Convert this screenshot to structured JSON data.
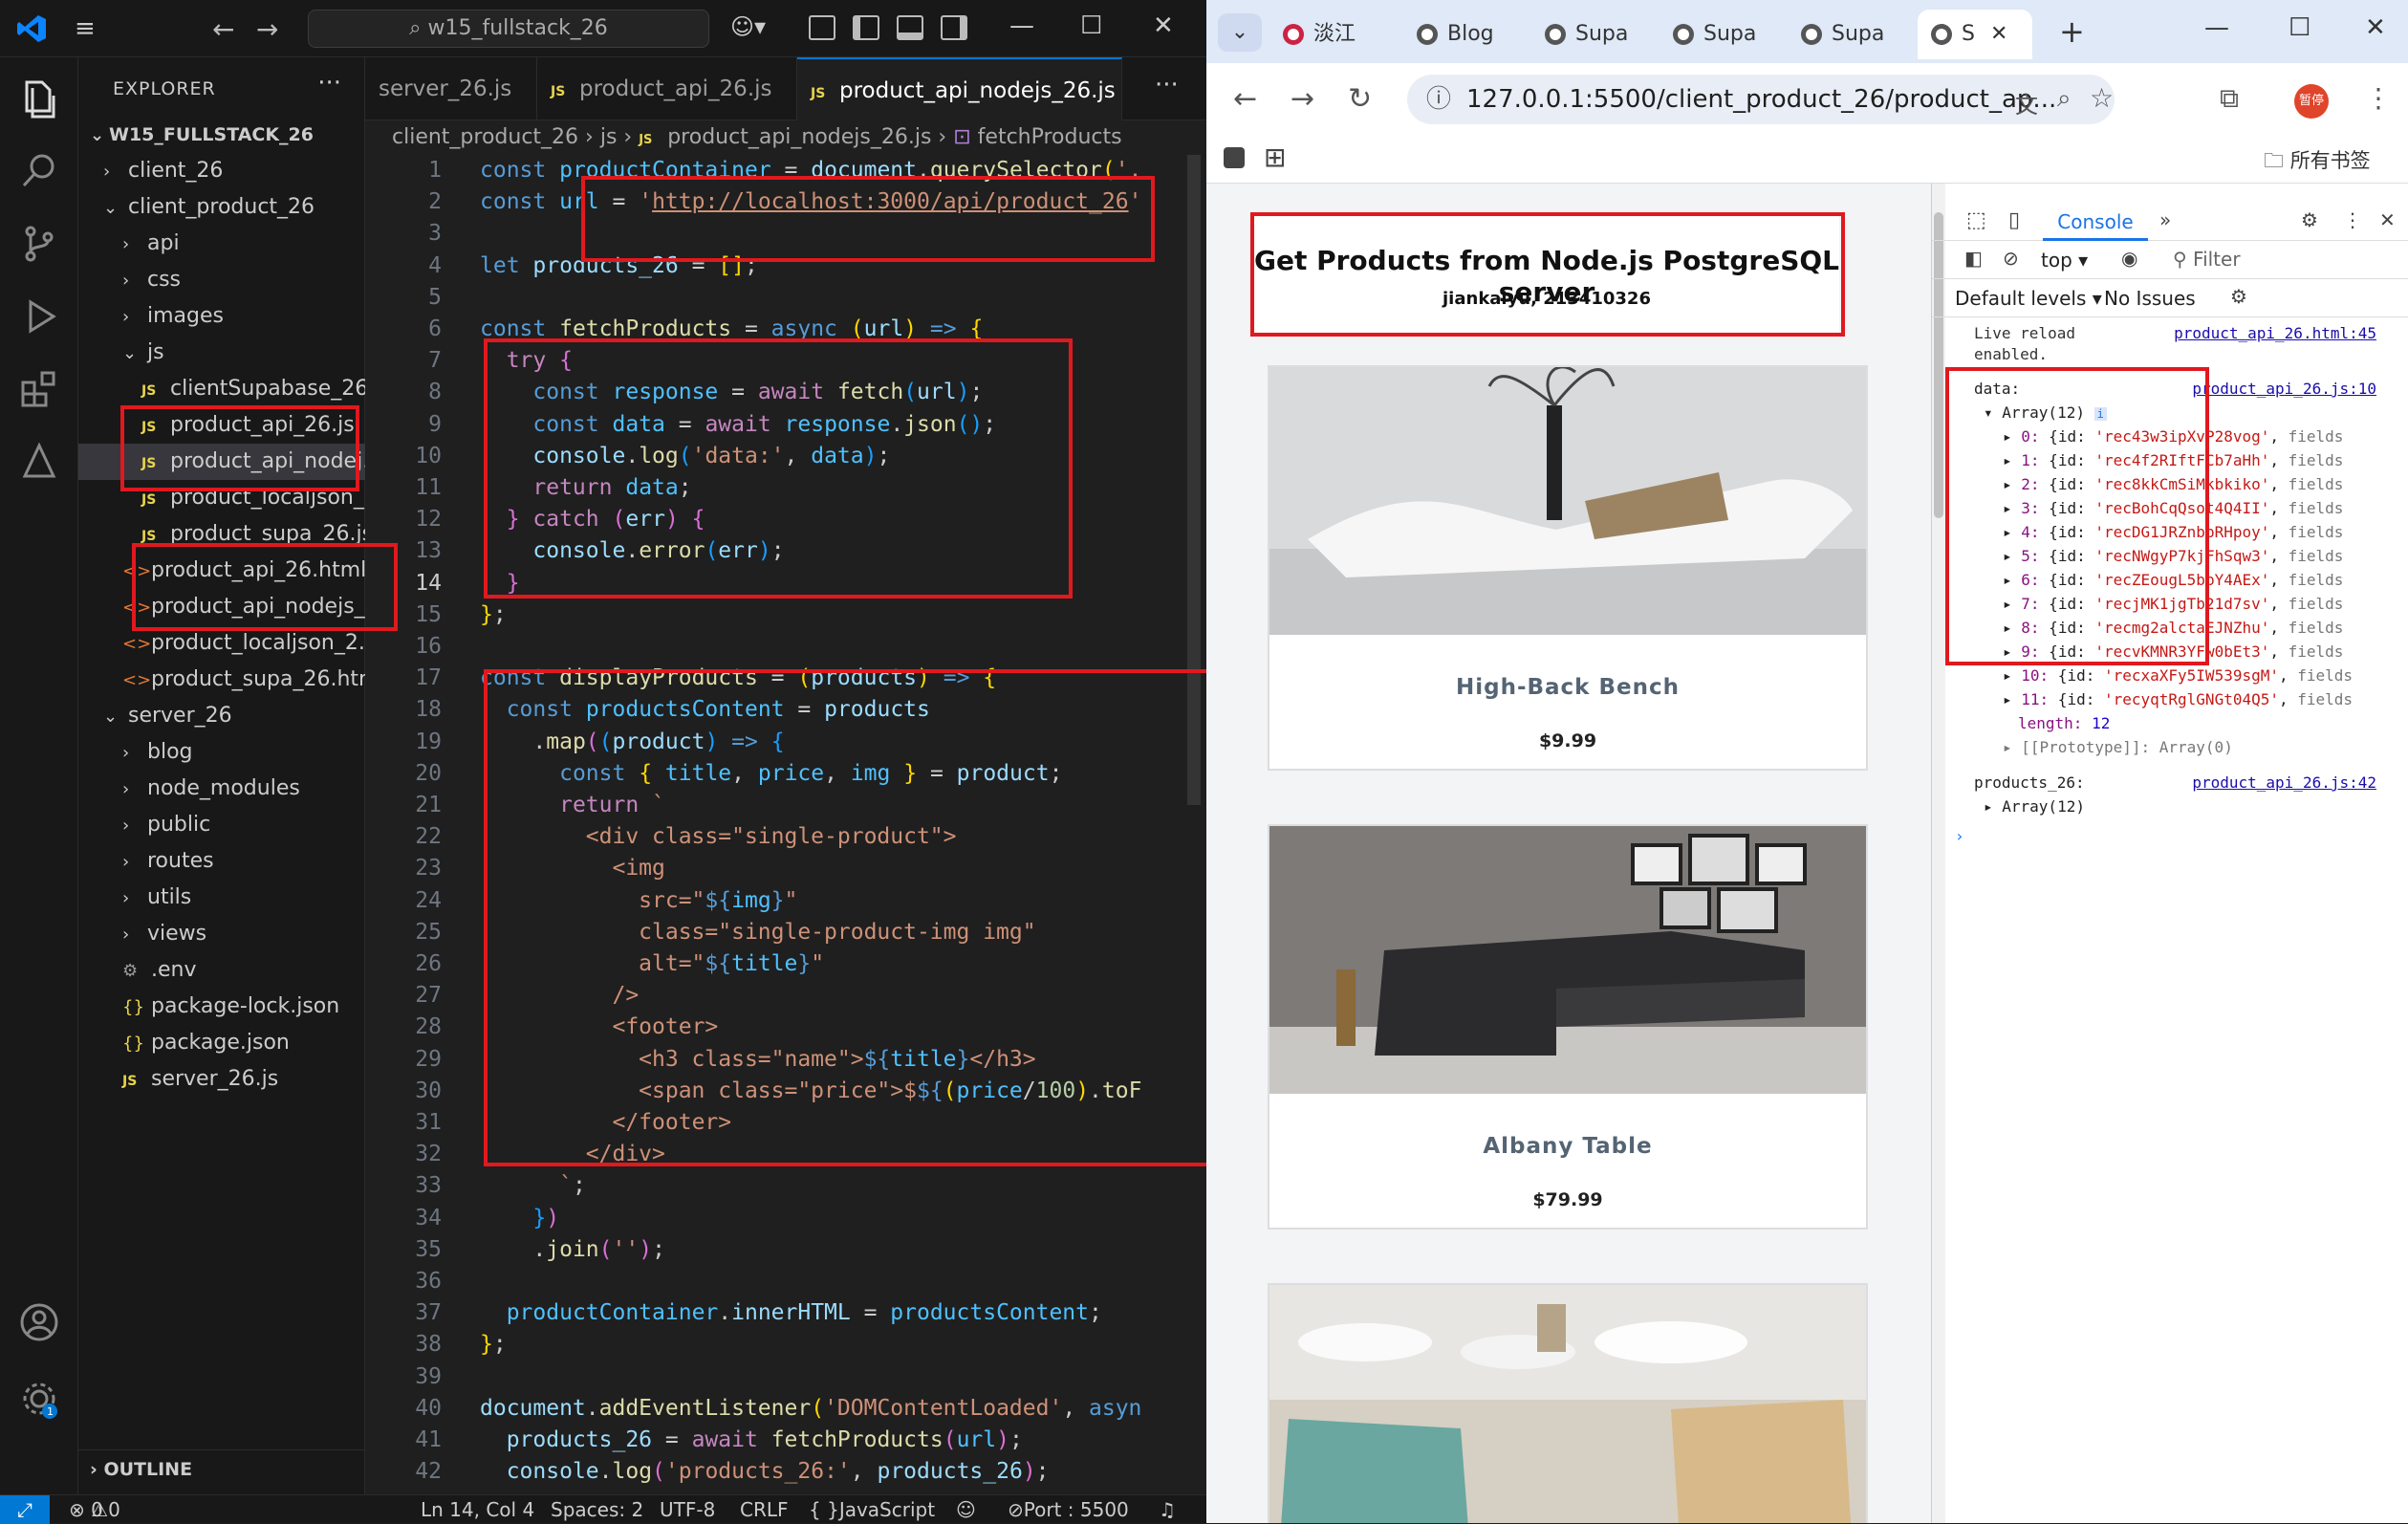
{
  "vscode": {
    "search": "w15_fullstack_26",
    "explorer_title": "EXPLORER",
    "root": "W15_FULLSTACK_26",
    "tree": [
      {
        "label": "client_26",
        "kind": "folder-closed",
        "indent": 1
      },
      {
        "label": "client_product_26",
        "kind": "folder-open",
        "indent": 1
      },
      {
        "label": "api",
        "kind": "folder-closed",
        "indent": 2
      },
      {
        "label": "css",
        "kind": "folder-closed",
        "indent": 2
      },
      {
        "label": "images",
        "kind": "folder-closed",
        "indent": 2
      },
      {
        "label": "js",
        "kind": "folder-open",
        "indent": 2
      },
      {
        "label": "clientSupabase_26.js",
        "kind": "js",
        "indent": 3
      },
      {
        "label": "product_api_26.js",
        "kind": "js",
        "indent": 3
      },
      {
        "label": "product_api_nodej...",
        "kind": "js",
        "indent": 3,
        "selected": true
      },
      {
        "label": "product_localjson_...",
        "kind": "js",
        "indent": 3
      },
      {
        "label": "product_supa_26.js",
        "kind": "js",
        "indent": 3
      },
      {
        "label": "product_api_26.html",
        "kind": "html",
        "indent": 2
      },
      {
        "label": "product_api_nodejs_...",
        "kind": "html",
        "indent": 2
      },
      {
        "label": "product_localjson_2...",
        "kind": "html",
        "indent": 2
      },
      {
        "label": "product_supa_26.html",
        "kind": "html",
        "indent": 2
      },
      {
        "label": "server_26",
        "kind": "folder-open",
        "indent": 1
      },
      {
        "label": "blog",
        "kind": "folder-closed",
        "indent": 2
      },
      {
        "label": "node_modules",
        "kind": "folder-closed",
        "indent": 2
      },
      {
        "label": "public",
        "kind": "folder-closed",
        "indent": 2
      },
      {
        "label": "routes",
        "kind": "folder-closed",
        "indent": 2
      },
      {
        "label": "utils",
        "kind": "folder-closed",
        "indent": 2
      },
      {
        "label": "views",
        "kind": "folder-closed",
        "indent": 2
      },
      {
        "label": ".env",
        "kind": "env",
        "indent": 2
      },
      {
        "label": "package-lock.json",
        "kind": "json",
        "indent": 2
      },
      {
        "label": "package.json",
        "kind": "json",
        "indent": 2
      },
      {
        "label": "server_26.js",
        "kind": "js",
        "indent": 2
      }
    ],
    "outline": "OUTLINE",
    "tabs": [
      {
        "label": "server_26.js",
        "badge": ""
      },
      {
        "label": "product_api_26.js",
        "badge": "JS"
      },
      {
        "label": "product_api_nodejs_26.js",
        "badge": "JS"
      }
    ],
    "breadcrumb": {
      "p1": "client_product_26",
      "p2": "js",
      "p3": "product_api_nodejs_26.js",
      "p4": "fetchProducts"
    },
    "current_line": 14,
    "status": {
      "errors": "0",
      "warnings": "0",
      "position": "Ln 14, Col 4",
      "spaces": "Spaces: 2",
      "encoding": "UTF-8",
      "eol": "CRLF",
      "language": "JavaScript",
      "port": "Port : 5500"
    }
  },
  "chrome": {
    "tabs": [
      "淡江",
      "Blog",
      "Supa",
      "Supa",
      "Supa",
      "S"
    ],
    "url": "127.0.0.1:5500/client_product_26/product_ap...",
    "bookmarks_label": "所有书签",
    "avatar_label": "暂停"
  },
  "page": {
    "title": "Get Products from Node.js PostgreSQL server",
    "subtitle": "jiankaiyu, 213410326",
    "products": [
      {
        "name": "High-Back Bench",
        "price": "$9.99"
      },
      {
        "name": "Albany Table",
        "price": "$79.99"
      },
      {
        "name": "",
        "price": ""
      }
    ]
  },
  "devtools": {
    "tab": "Console",
    "context": "top",
    "filter_placeholder": "Filter",
    "levels": "Default levels",
    "issues": "No Issues",
    "live_reload": "Live reload",
    "live_reload2": "enabled.",
    "live_link": "product_api_26.html:45",
    "data_label": "data:",
    "data_link": "product_api_26.js:10",
    "array_label": "Array(12)",
    "items": [
      {
        "idx": "0",
        "id": "'rec43w3ipXvP28vog'"
      },
      {
        "idx": "1",
        "id": "'rec4f2RIftFCb7aHh'"
      },
      {
        "idx": "2",
        "id": "'rec8kkCmSiMkbkiko'"
      },
      {
        "idx": "3",
        "id": "'recBohCqQsot4Q4II'"
      },
      {
        "idx": "4",
        "id": "'recDG1JRZnbpRHpoy'"
      },
      {
        "idx": "5",
        "id": "'recNWgyP7kjFhSqw3'"
      },
      {
        "idx": "6",
        "id": "'recZEougL5bbY4AEx'"
      },
      {
        "idx": "7",
        "id": "'recjMK1jgTb21d7sv'"
      },
      {
        "idx": "8",
        "id": "'recmg2alctaEJNZhu'"
      },
      {
        "idx": "9",
        "id": "'recvKMNR3YFw0bEt3'"
      },
      {
        "idx": "10",
        "id": "'recxaXFy5IW539sgM'"
      },
      {
        "idx": "11",
        "id": "'recyqtRglGNGt04Q5'"
      }
    ],
    "length_label": "length:",
    "length_val": "12",
    "prototype": "[[Prototype]]: Array(0)",
    "products_label": "products_26:",
    "products_link": "product_api_26.js:42",
    "products_array": "Array(12)"
  }
}
